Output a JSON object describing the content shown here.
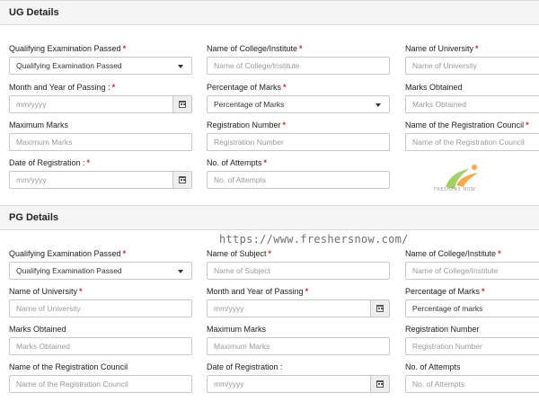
{
  "ug": {
    "title": "UG Details",
    "fields": [
      {
        "label": "Qualifying Examination Passed",
        "required": "*",
        "value": "Qualifying Examination Passed"
      },
      {
        "label": "Name of College/Institute",
        "required": "*",
        "placeholder": "Name of College/Institute"
      },
      {
        "label": "Name of University",
        "required": "*",
        "placeholder": "Name of University"
      },
      {
        "label": "Month and Year of Passing :",
        "required": "*",
        "placeholder": "mm/yyyy"
      },
      {
        "label": "Percentage of Marks",
        "required": "*",
        "value": "Percentage of Marks"
      },
      {
        "label": "Marks Obtained",
        "placeholder": "Marks Obtained"
      },
      {
        "label": "Maximum Marks",
        "placeholder": "Maximum Marks"
      },
      {
        "label": "Registration Number",
        "required": "*",
        "placeholder": "Registration Number"
      },
      {
        "label": "Name of the Registration Council",
        "required": "*",
        "placeholder": "Name of the Registration Council"
      },
      {
        "label": "Date of Registration :",
        "required": "*",
        "placeholder": "mm/yyyy"
      },
      {
        "label": "No. of Attempts",
        "required": "*",
        "placeholder": "No. of Attempts"
      }
    ]
  },
  "pg": {
    "title": "PG Details",
    "fields": [
      {
        "label": "Qualifying Examination Passed",
        "required": "*",
        "value": "Qualifying Examination Passed"
      },
      {
        "label": "Name of Subject",
        "required": "*",
        "placeholder": "Name of Subject"
      },
      {
        "label": "Name of College/Institute",
        "required": "*",
        "placeholder": "Name of College/Institute"
      },
      {
        "label": "Name of University",
        "required": "*",
        "placeholder": "Name of University"
      },
      {
        "label": "Month and Year of Passing",
        "required": "*",
        "placeholder": "mm/yyyy"
      },
      {
        "label": "Percentage of Marks",
        "required": "*",
        "value": "Percentage of marks"
      },
      {
        "label": "Marks Obtained",
        "placeholder": "Marks Obtained"
      },
      {
        "label": "Maximum Marks",
        "placeholder": "Maximum Marks"
      },
      {
        "label": "Registration Number",
        "placeholder": "Registration Number"
      },
      {
        "label": "Name of the Registration Council",
        "placeholder": "Name of the Registration Council"
      },
      {
        "label": "Date of Registration :",
        "placeholder": "mm/yyyy"
      },
      {
        "label": "No. of Attempts",
        "placeholder": "No. of Attempts"
      }
    ]
  },
  "watermark": {
    "logo_text": "FRESHERS NOW",
    "url": "https://www.freshersnow.com/"
  },
  "icons": {
    "dropdown": "chevron-down-icon",
    "calendar": "calendar-icon"
  },
  "colors": {
    "required": "#d9262c",
    "header_bg": "#f5f5f5",
    "border": "#c8c8c8"
  }
}
